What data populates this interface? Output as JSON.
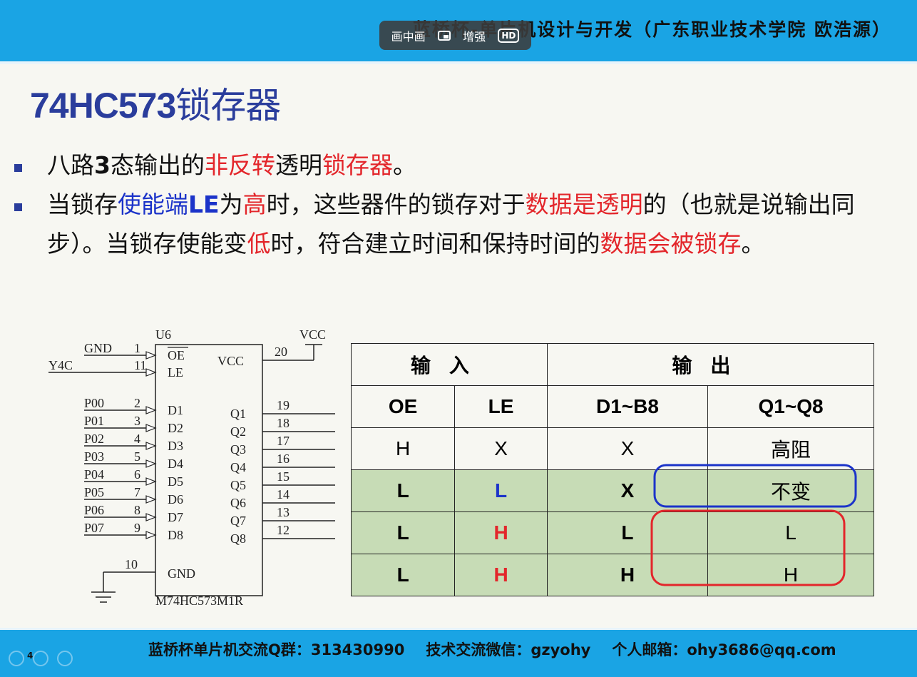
{
  "header": {
    "title": "蓝桥杯-单片机设计与开发（广东职业技术学院 欧浩源）"
  },
  "player_overlay": {
    "pip_label": "画中画",
    "enhance_label": "增强",
    "hd_label": "HD"
  },
  "slide": {
    "title_en": "74HC573",
    "title_cn": "锁存器",
    "bullet1": {
      "p1": "八路",
      "p2": "3",
      "p3": "态输出的",
      "p4": "非反转",
      "p5": "透明",
      "p6": "锁存器",
      "p7": "。"
    },
    "bullet2": {
      "p1": "当锁存",
      "p2": "使能端",
      "p3": "LE",
      "p4": "为",
      "p5": "高",
      "p6": "时，这些器件的锁存对于",
      "p7": "数据是透明",
      "p8": "的（也就是说输出同步）。当锁存使能变",
      "p9": "低",
      "p10": "时，符合建立时间和保持时间的",
      "p11": "数据会被锁存",
      "p12": "。"
    }
  },
  "schematic": {
    "ref": "U6",
    "part": "M74HC573M1R",
    "vcc_label": "VCC",
    "gnd_label": "GND",
    "left_pins": [
      {
        "net": "GND",
        "num": "1",
        "name": "OE"
      },
      {
        "net": "Y4C",
        "num": "11",
        "name": "LE"
      },
      {
        "net": "P00",
        "num": "2",
        "name": "D1"
      },
      {
        "net": "P01",
        "num": "3",
        "name": "D2"
      },
      {
        "net": "P02",
        "num": "4",
        "name": "D3"
      },
      {
        "net": "P03",
        "num": "5",
        "name": "D4"
      },
      {
        "net": "P04",
        "num": "6",
        "name": "D5"
      },
      {
        "net": "P05",
        "num": "7",
        "name": "D6"
      },
      {
        "net": "P06",
        "num": "8",
        "name": "D7"
      },
      {
        "net": "P07",
        "num": "9",
        "name": "D8"
      }
    ],
    "right_pins": [
      {
        "num": "19",
        "name": "Q1"
      },
      {
        "num": "18",
        "name": "Q2"
      },
      {
        "num": "17",
        "name": "Q3"
      },
      {
        "num": "16",
        "name": "Q4"
      },
      {
        "num": "15",
        "name": "Q5"
      },
      {
        "num": "14",
        "name": "Q6"
      },
      {
        "num": "13",
        "name": "Q7"
      },
      {
        "num": "12",
        "name": "Q8"
      }
    ],
    "vcc_pin": {
      "num": "20",
      "name": "VCC"
    },
    "gnd_pin": {
      "num": "10",
      "name": "GND"
    }
  },
  "truth_table": {
    "group_headers": [
      "输入",
      "输出"
    ],
    "columns": [
      "OE",
      "LE",
      "D1~B8",
      "Q1~Q8"
    ],
    "rows": [
      [
        "H",
        "X",
        "X",
        "高阻"
      ],
      [
        "L",
        "L",
        "X",
        "不变"
      ],
      [
        "L",
        "H",
        "L",
        "L"
      ],
      [
        "L",
        "H",
        "H",
        "H"
      ]
    ]
  },
  "footer": {
    "qq_group": "蓝桥杯单片机交流Q群：313430990",
    "wechat": "技术交流微信：gzyohy",
    "email": "个人邮箱：ohy3686@qq.com",
    "page": "4"
  },
  "colors": {
    "bar": "#1aa4e4",
    "title": "#2a3d9c",
    "highlight": "#e3262b",
    "blue": "#1b33c9",
    "green_row": "#c7dcb6"
  }
}
